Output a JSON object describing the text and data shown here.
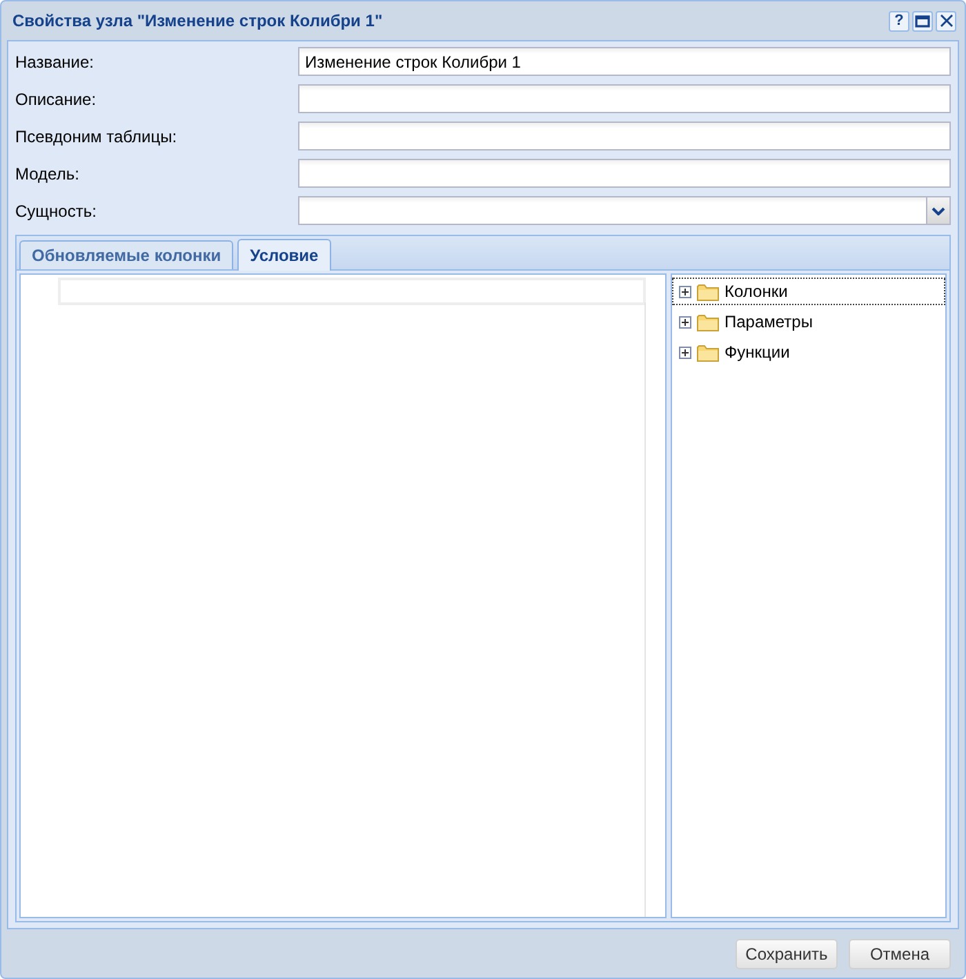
{
  "window": {
    "title": "Свойства узла \"Изменение строк Колибри 1\"",
    "tools": [
      "?"
    ]
  },
  "fields": [
    {
      "label": "Название:",
      "value": "Изменение строк Колибри 1",
      "kind": "text"
    },
    {
      "label": "Описание:",
      "kind": "text"
    },
    {
      "label": "Псевдоним таблицы:",
      "kind": "text"
    },
    {
      "label": "Модель:",
      "kind": "text"
    },
    {
      "label": "Сущность:",
      "kind": "combo"
    }
  ],
  "tabs": [
    {
      "label": "Обновляемые колонки",
      "selected": false
    },
    {
      "label": "Условие",
      "selected": true
    }
  ],
  "tree": [
    {
      "label": "Колонки",
      "selected": true,
      "expanded": false
    },
    {
      "label": "Параметры",
      "selected": false,
      "expanded": false
    },
    {
      "label": "Функции",
      "selected": false,
      "expanded": false
    }
  ],
  "buttons": [
    "Сохранить",
    "Отмена"
  ]
}
